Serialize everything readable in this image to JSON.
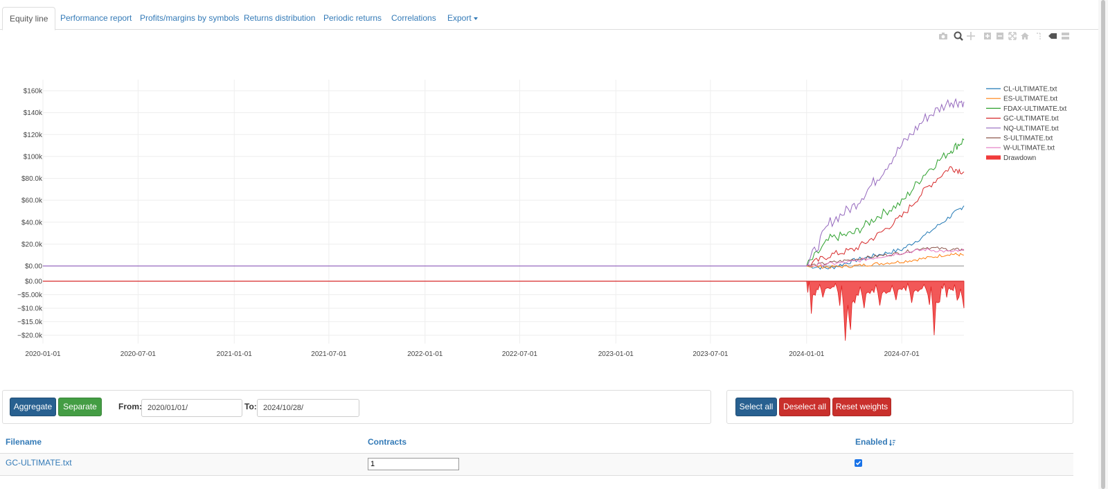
{
  "tabs": [
    {
      "label": "Equity line",
      "active": true
    },
    {
      "label": "Performance report"
    },
    {
      "label": "Profits/margins by symbols"
    },
    {
      "label": "Returns distribution"
    },
    {
      "label": "Periodic returns"
    },
    {
      "label": "Correlations"
    },
    {
      "label": "Export"
    }
  ],
  "toolbar_icons": [
    "camera-icon",
    "zoom-icon",
    "pan-icon",
    "zoom-in-icon",
    "zoom-out-icon",
    "autoscale-icon",
    "home-icon",
    "spike-lines-icon",
    "hover-closest-icon",
    "hover-compare-icon"
  ],
  "chart_data": {
    "type": "line",
    "x_ticks": [
      "2020-01-01",
      "2020-07-01",
      "2021-01-01",
      "2021-07-01",
      "2022-01-01",
      "2022-07-01",
      "2023-01-01",
      "2023-07-01",
      "2024-01-01",
      "2024-07-01"
    ],
    "x_range": [
      "2020-01-01",
      "2024-10-28"
    ],
    "equity_y_ticks": [
      "$160k",
      "$140k",
      "$120k",
      "$100k",
      "$80.0k",
      "$60.0k",
      "$40.0k",
      "$20.0k",
      "$0.00"
    ],
    "equity_ylim": [
      0,
      160000
    ],
    "drawdown_y_ticks": [
      "$0.00",
      "−$5.00k",
      "−$10.0k",
      "−$15.0k",
      "−$20.0k"
    ],
    "drawdown_ylim": [
      -20000,
      0
    ],
    "grid": true,
    "legend_position": "top-right",
    "series": [
      {
        "name": "CL-ULTIMATE.txt",
        "color": "#1f77b4",
        "x": [
          "2024-01-01",
          "2024-02-15",
          "2024-04-01",
          "2024-05-15",
          "2024-07-01",
          "2024-08-15",
          "2024-10-01",
          "2024-10-28"
        ],
        "y": [
          0,
          -2000,
          5000,
          10000,
          15000,
          28000,
          45000,
          55000
        ]
      },
      {
        "name": "ES-ULTIMATE.txt",
        "color": "#ff7f0e",
        "x": [
          "2024-01-01",
          "2024-02-15",
          "2024-04-01",
          "2024-05-15",
          "2024-07-01",
          "2024-08-15",
          "2024-10-01",
          "2024-10-28"
        ],
        "y": [
          0,
          -1000,
          0,
          2000,
          4000,
          7000,
          11000,
          10000
        ]
      },
      {
        "name": "FDAX-ULTIMATE.txt",
        "color": "#2ca02c",
        "x": [
          "2024-01-01",
          "2024-02-15",
          "2024-04-01",
          "2024-05-15",
          "2024-07-01",
          "2024-08-15",
          "2024-10-01",
          "2024-10-28"
        ],
        "y": [
          0,
          25000,
          30000,
          45000,
          58000,
          85000,
          105000,
          115000
        ]
      },
      {
        "name": "GC-ULTIMATE.txt",
        "color": "#d62728",
        "x": [
          "2024-01-01",
          "2024-02-15",
          "2024-04-01",
          "2024-05-15",
          "2024-07-01",
          "2024-08-15",
          "2024-10-01",
          "2024-10-28"
        ],
        "y": [
          0,
          10000,
          15000,
          28000,
          45000,
          70000,
          90000,
          86000
        ]
      },
      {
        "name": "NQ-ULTIMATE.txt",
        "color": "#9467bd",
        "x": [
          "2024-01-01",
          "2024-02-15",
          "2024-04-01",
          "2024-05-15",
          "2024-07-01",
          "2024-08-15",
          "2024-10-01",
          "2024-10-28"
        ],
        "y": [
          0,
          40000,
          55000,
          80000,
          110000,
          135000,
          150000,
          150000
        ]
      },
      {
        "name": "S-ULTIMATE.txt",
        "color": "#8c564b",
        "x": [
          "2024-01-01",
          "2024-02-15",
          "2024-04-01",
          "2024-05-15",
          "2024-07-01",
          "2024-08-15",
          "2024-10-01",
          "2024-10-28"
        ],
        "y": [
          0,
          3000,
          6000,
          9000,
          12000,
          17000,
          15000,
          15000
        ]
      },
      {
        "name": "W-ULTIMATE.txt",
        "color": "#e377c2",
        "x": [
          "2024-01-01",
          "2024-02-15",
          "2024-04-01",
          "2024-05-15",
          "2024-07-01",
          "2024-08-15",
          "2024-10-01",
          "2024-10-28"
        ],
        "y": [
          0,
          2000,
          4000,
          8000,
          12000,
          15000,
          13000,
          14000
        ]
      }
    ],
    "drawdown": {
      "name": "Drawdown",
      "color": "#f03b3b",
      "x": [
        "2024-01-01",
        "2024-01-10",
        "2024-01-20",
        "2024-02-01",
        "2024-02-20",
        "2024-03-01",
        "2024-03-15",
        "2024-03-25",
        "2024-04-05",
        "2024-04-20",
        "2024-05-05",
        "2024-05-20",
        "2024-06-05",
        "2024-06-20",
        "2024-07-05",
        "2024-07-20",
        "2024-08-05",
        "2024-08-20",
        "2024-09-01",
        "2024-09-15",
        "2024-09-25",
        "2024-10-05",
        "2024-10-15",
        "2024-10-28"
      ],
      "y": [
        0,
        -12000,
        -3000,
        -6000,
        -2000,
        -4000,
        -22000,
        -18000,
        -5000,
        -10000,
        -3000,
        -9000,
        -4000,
        -7000,
        -2000,
        -8000,
        -3000,
        -5000,
        -20000,
        -2000,
        -6000,
        -3000,
        -7000,
        -10000
      ]
    }
  },
  "controls": {
    "aggregate_label": "Aggregate",
    "separate_label": "Separate",
    "from_label": "From:",
    "from_value": "2020/01/01/",
    "to_label": "To:",
    "to_value": "2024/10/28/",
    "select_all_label": "Select all",
    "deselect_all_label": "Deselect all",
    "reset_weights_label": "Reset weights"
  },
  "table": {
    "headers": {
      "filename": "Filename",
      "contracts": "Contracts",
      "enabled": "Enabled"
    },
    "rows": [
      {
        "filename": "GC-ULTIMATE.txt",
        "contracts": "1",
        "enabled": true
      }
    ]
  }
}
